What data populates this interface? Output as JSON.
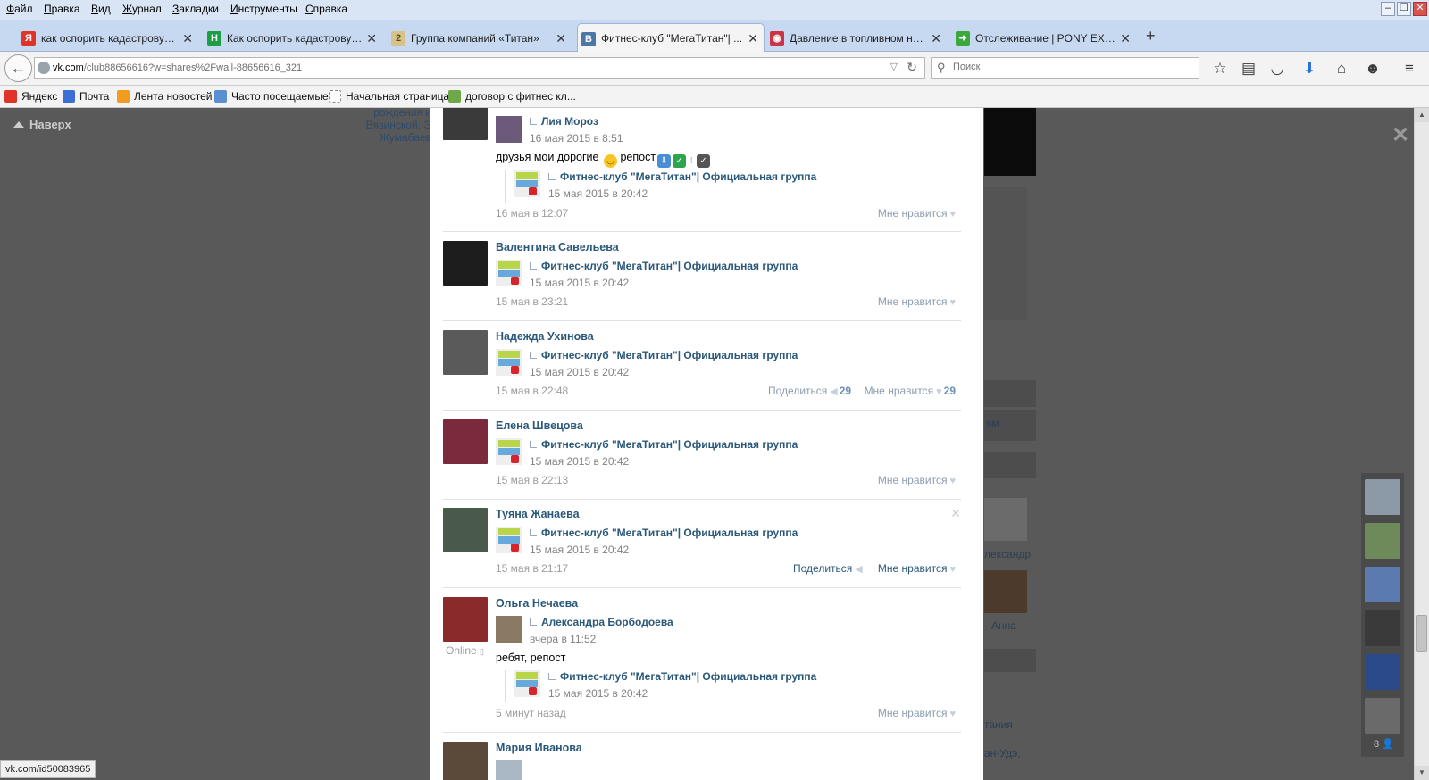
{
  "menu": [
    "Файл",
    "Правка",
    "Вид",
    "Журнал",
    "Закладки",
    "Инструменты",
    "Справка"
  ],
  "tabs": [
    {
      "label": "как оспорить кадастровую ...",
      "icon": "yandex-icon",
      "color": "#e0342b",
      "glyph": "Я"
    },
    {
      "label": "Как оспорить кадастровую...",
      "icon": "h-letter-icon",
      "color": "#1c9e44",
      "glyph": "H"
    },
    {
      "label": "Группа компаний «Титан»",
      "icon": "titan-icon",
      "color": "#d7c38a",
      "glyph": "2"
    },
    {
      "label": "Фитнес-клуб \"МегаТитан\"| ...",
      "icon": "vk-icon",
      "color": "#4a76a8",
      "glyph": "B"
    },
    {
      "label": "Давление в топливном насо...",
      "icon": "auto-icon",
      "color": "#cc3344",
      "glyph": "◉"
    },
    {
      "label": "Отслеживание | PONY EXPR...",
      "icon": "pony-express-icon",
      "color": "#3aa83a",
      "glyph": "➜"
    }
  ],
  "url": {
    "domain": "vk.com",
    "path": "/club88656616?w=shares%2Fwall-88656616_321"
  },
  "search_placeholder": "Поиск",
  "bookmarks": [
    {
      "label": "Яндекс",
      "icon": "yandex-icon",
      "color": "#e0342b"
    },
    {
      "label": "Почта",
      "icon": "mail-icon",
      "color": "#3b6fd6"
    },
    {
      "label": "Лента новостей",
      "icon": "rss-icon",
      "color": "#f29b1f"
    },
    {
      "label": "Часто посещаемые",
      "icon": "search-folder-icon",
      "color": "#5a8fd0"
    },
    {
      "label": "Начальная страница",
      "icon": "page-icon",
      "color": "#ffffff"
    },
    {
      "label": "договор с фитнес кл...",
      "icon": "u-letter-icon",
      "color": "#6fa84a"
    }
  ],
  "page": {
    "top_link": "Наверх",
    "bg_text": [
      "рождения и",
      "Вязинской, Э",
      "Жумабаев"
    ],
    "bg_names": [
      "лександр",
      "Анна",
      "тания",
      "ан-Удэ,",
      "ям"
    ],
    "status_url": "vk.com/id50083965",
    "friends_count": "8"
  },
  "shared_group": {
    "name": "Фитнес-клуб \"МегаТитан\"| Официальная группа",
    "date": "15 мая 2015 в 20:42"
  },
  "posts": [
    {
      "name": "Лия Мороз",
      "date": "16 мая 2015 в 8:51",
      "text": "друзья мои дорогие",
      "text2": "репост",
      "footer_time": "16 мая в 12:07",
      "like": "Мне нравится"
    },
    {
      "name": "Валентина Савельева",
      "footer_time": "15 мая в 23:21",
      "like": "Мне нравится"
    },
    {
      "name": "Надежда Ухинова",
      "footer_time": "15 мая в 22:48",
      "share": "Поделиться",
      "share_count": "29",
      "like": "Мне нравится",
      "like_count": "29"
    },
    {
      "name": "Елена Швецова",
      "footer_time": "15 мая в 22:13",
      "like": "Мне нравится"
    },
    {
      "name": "Туяна Жанаева",
      "footer_time": "15 мая в 21:17",
      "share": "Поделиться",
      "like": "Мне нравится"
    },
    {
      "name": "Ольга Нечаева",
      "online": "Online",
      "repost_author": "Александра Борбодоева",
      "repost_date": "вчера в 11:52",
      "text": "ребят, репост",
      "footer_time": "5 минут назад",
      "like": "Мне нравится"
    },
    {
      "name": "Мария Иванова"
    }
  ]
}
